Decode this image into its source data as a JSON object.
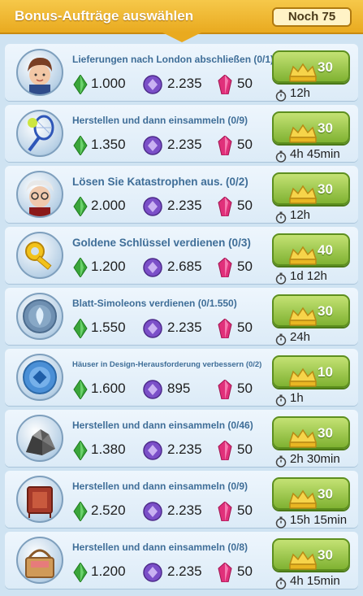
{
  "header": {
    "title": "Bonus-Aufträge auswählen",
    "remaining": "Noch 75"
  },
  "colors": {
    "header": "#f0b932",
    "row_bg": "#e6f1fa",
    "button_green": "#8cc63f",
    "task_text": "#3f6e98",
    "simoleon_green": "#3aa53a",
    "xp_purple": "#7b4fc8",
    "gem_pink": "#e0307a"
  },
  "icons": {
    "simoleon": "simoleon-icon",
    "xp": "xp-icon",
    "simcash": "simcash-icon",
    "crown": "golden-key-crown-icon",
    "stopwatch": "stopwatch-icon"
  },
  "tasks": [
    {
      "avatar": "woman-avatar",
      "title": "Lieferungen nach London abschließen (0/1)",
      "simoleons": "1.000",
      "xp": "2.235",
      "simcash": "50",
      "keys": "30",
      "time": "12h",
      "size": "normal"
    },
    {
      "avatar": "tennis-racket",
      "title": "Herstellen und dann einsammeln (0/9)",
      "simoleons": "1.350",
      "xp": "2.235",
      "simcash": "50",
      "keys": "30",
      "time": "4h 45min",
      "size": "normal"
    },
    {
      "avatar": "dr-vu",
      "title": "Lösen Sie Katastrophen aus. (0/2)",
      "simoleons": "2.000",
      "xp": "2.235",
      "simcash": "50",
      "keys": "30",
      "time": "12h",
      "size": "big"
    },
    {
      "avatar": "golden-key",
      "title": "Goldene Schlüssel verdienen (0/3)",
      "simoleons": "1.200",
      "xp": "2.685",
      "simcash": "50",
      "keys": "40",
      "time": "1d 12h",
      "size": "big"
    },
    {
      "avatar": "leaf-coin",
      "title": "Blatt-Simoleons verdienen (0/1.550)",
      "simoleons": "1.550",
      "xp": "2.235",
      "simcash": "50",
      "keys": "30",
      "time": "24h",
      "size": "normal"
    },
    {
      "avatar": "design-token",
      "title": "Häuser in Design-Herausforderung verbessern (0/2)",
      "simoleons": "1.600",
      "xp": "895",
      "simcash": "50",
      "keys": "10",
      "time": "1h",
      "size": "tiny"
    },
    {
      "avatar": "metal-pile",
      "title": "Herstellen und dann einsammeln (0/46)",
      "simoleons": "1.380",
      "xp": "2.235",
      "simcash": "50",
      "keys": "30",
      "time": "2h 30min",
      "size": "normal"
    },
    {
      "avatar": "red-rug",
      "title": "Herstellen und dann einsammeln (0/9)",
      "simoleons": "2.520",
      "xp": "2.235",
      "simcash": "50",
      "keys": "30",
      "time": "15h 15min",
      "size": "normal"
    },
    {
      "avatar": "picnic-basket",
      "title": "Herstellen und dann einsammeln (0/8)",
      "simoleons": "1.200",
      "xp": "2.235",
      "simcash": "50",
      "keys": "30",
      "time": "4h 15min",
      "size": "normal"
    }
  ]
}
